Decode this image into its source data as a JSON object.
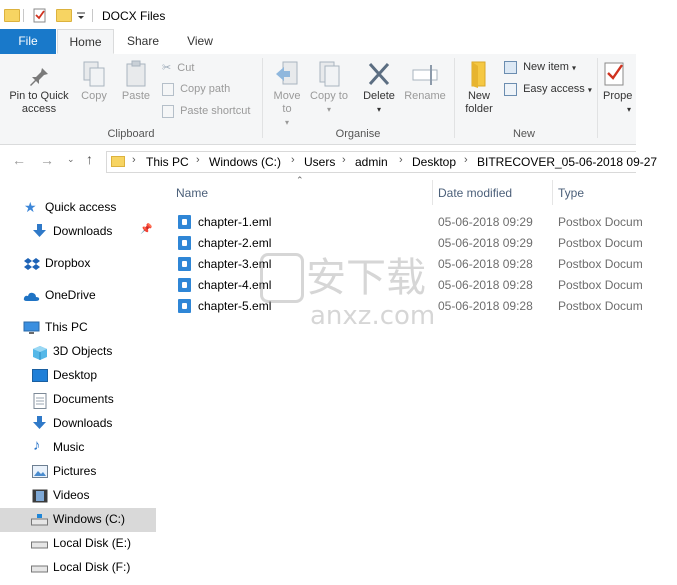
{
  "window": {
    "title": "DOCX Files"
  },
  "tabs": [
    "File",
    "Home",
    "Share",
    "View"
  ],
  "ribbon": {
    "clipboard": {
      "pin_label": "Pin to Quick access",
      "copy_label": "Copy",
      "paste_label": "Paste",
      "cut_label": "Cut",
      "copy_path_label": "Copy path",
      "paste_shortcut_label": "Paste shortcut",
      "group_label": "Clipboard"
    },
    "organise": {
      "move_to_label": "Move to",
      "copy_to_label": "Copy to",
      "delete_label": "Delete",
      "rename_label": "Rename",
      "group_label": "Organise"
    },
    "new": {
      "new_folder_label": "New folder",
      "new_item_label": "New item",
      "easy_access_label": "Easy access",
      "group_label": "New"
    },
    "open": {
      "properties_label": "Prope"
    }
  },
  "address": {
    "crumbs": [
      "This PC",
      "Windows (C:)",
      "Users",
      "admin",
      "Desktop",
      "BITRECOVER_05-06-2018 09-27"
    ]
  },
  "nav": {
    "items": [
      {
        "label": "Quick access",
        "icon": "star-icon"
      },
      {
        "label": "Downloads",
        "icon": "download-icon"
      },
      {
        "label": "Dropbox",
        "icon": "dropbox-icon"
      },
      {
        "label": "OneDrive",
        "icon": "cloud-icon"
      },
      {
        "label": "This PC",
        "icon": "monitor-icon"
      },
      {
        "label": "3D Objects",
        "icon": "cube-icon"
      },
      {
        "label": "Desktop",
        "icon": "desktop-icon"
      },
      {
        "label": "Documents",
        "icon": "document-icon"
      },
      {
        "label": "Downloads",
        "icon": "download-icon"
      },
      {
        "label": "Music",
        "icon": "music-icon"
      },
      {
        "label": "Pictures",
        "icon": "picture-icon"
      },
      {
        "label": "Videos",
        "icon": "video-icon"
      },
      {
        "label": "Windows (C:)",
        "icon": "drive-icon"
      },
      {
        "label": "Local Disk (E:)",
        "icon": "drive-icon"
      },
      {
        "label": "Local Disk (F:)",
        "icon": "drive-icon"
      }
    ]
  },
  "files": {
    "columns": [
      "Name",
      "Date modified",
      "Type"
    ],
    "rows": [
      {
        "name": "chapter-1.eml",
        "date": "05-06-2018 09:29",
        "type": "Postbox Docum"
      },
      {
        "name": "chapter-2.eml",
        "date": "05-06-2018 09:29",
        "type": "Postbox Docum"
      },
      {
        "name": "chapter-3.eml",
        "date": "05-06-2018 09:28",
        "type": "Postbox Docum"
      },
      {
        "name": "chapter-4.eml",
        "date": "05-06-2018 09:28",
        "type": "Postbox Docum"
      },
      {
        "name": "chapter-5.eml",
        "date": "05-06-2018 09:28",
        "type": "Postbox Docum"
      }
    ]
  },
  "watermark": {
    "cn": "安下载",
    "en": "anxz.com"
  },
  "colors": {
    "file_tab": "#1979ca",
    "selection": "#d9d9d9",
    "eml_icon": "#2f86d6",
    "header_text": "#4c607a"
  }
}
